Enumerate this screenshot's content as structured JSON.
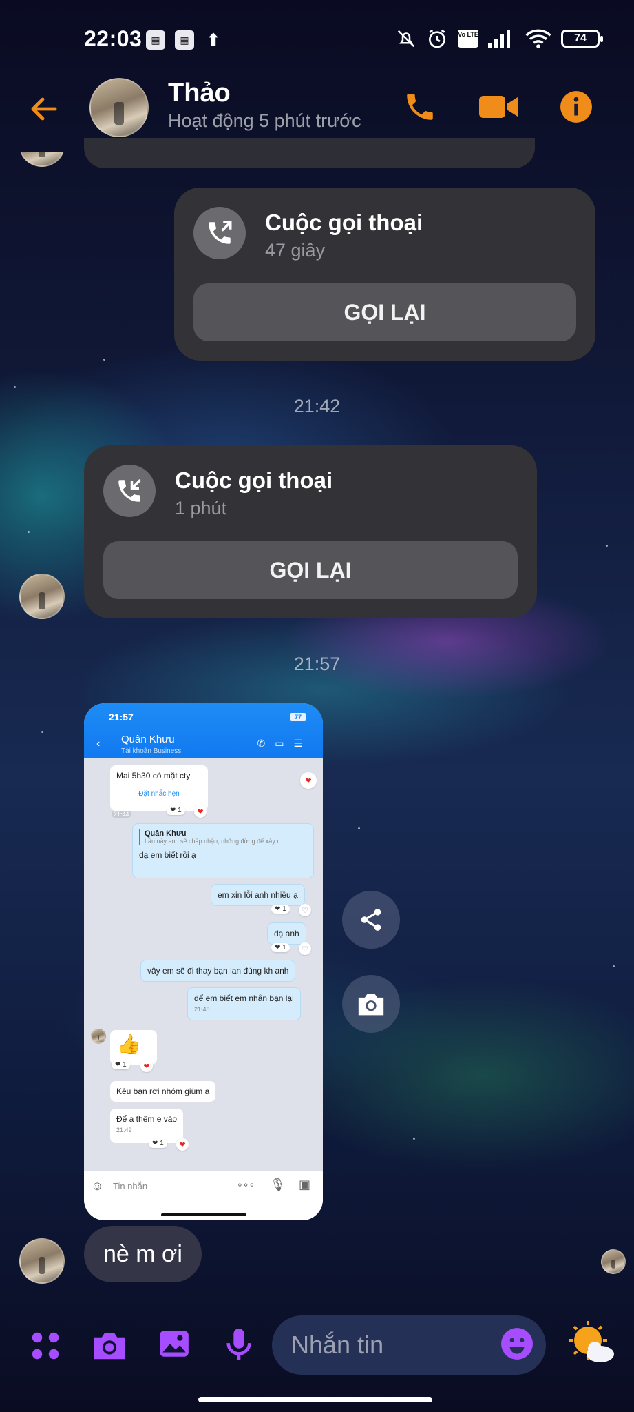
{
  "status_bar": {
    "time": "22:03",
    "battery": "74",
    "network_badge": "Vo LTE"
  },
  "header": {
    "contact_name": "Thảo",
    "status": "Hoạt động 5 phút trước",
    "accent_color": "#f08c1a"
  },
  "messages": [
    {
      "type": "call",
      "direction": "outgoing",
      "title": "Cuộc gọi thoại",
      "duration": "47 giây",
      "button": "GỌI LẠI"
    },
    {
      "type": "timestamp",
      "text": "21:42"
    },
    {
      "type": "call",
      "direction": "incoming",
      "title": "Cuộc gọi thoại",
      "duration": "1 phút",
      "button": "GỌI LẠI"
    },
    {
      "type": "timestamp",
      "text": "21:57"
    },
    {
      "type": "image",
      "description_text": {
        "time": "21:57",
        "battery": "77",
        "name": "Quân Khưu",
        "subtitle": "Tài khoản Business",
        "b1": "Mai 5h30 có mặt cty",
        "b1_link": "Đặt nhắc hẹn",
        "b1_time": "21:44",
        "quote_name": "Quân Khưu",
        "quote_text": "Lần này anh sẽ chấp nhận, những đừng để xảy r...",
        "b2": "dạ em biết rồi ạ",
        "b3": "em xin lỗi anh nhiều ạ",
        "b4": "dạ anh",
        "b5": "vậy em sẽ đi thay bạn lan đúng kh anh",
        "b6": "để em biết em nhắn bạn lại",
        "b6_time": "21:48",
        "b7": "👍",
        "b8": "Kêu bạn rời nhóm giùm a",
        "b9": "Để a thêm e vào",
        "b9_time": "21:49",
        "input_placeholder": "Tin nhắn",
        "react_count": "1"
      }
    },
    {
      "type": "text",
      "text": "nè m ơi"
    }
  ],
  "composer": {
    "placeholder": "Nhắn tin",
    "accent_color": "#a64dff"
  }
}
